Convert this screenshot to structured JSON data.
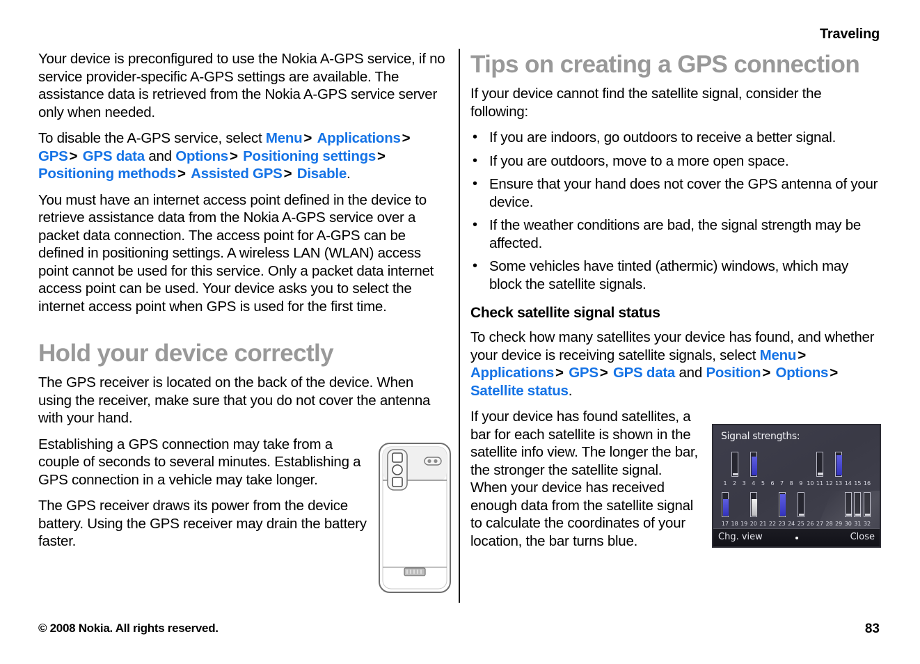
{
  "header": {
    "running_head": "Traveling"
  },
  "footer": {
    "copyright": "© 2008 Nokia. All rights reserved.",
    "page_number": "83"
  },
  "colors": {
    "link_blue": "#1573e6",
    "heading_gray": "#999999",
    "body_black": "#000000",
    "screen_bg": "#3a3a46",
    "bar_blue": "#3434bd"
  },
  "left_column": {
    "para_1": "Your device is preconfigured to use the Nokia A-GPS service, if no service provider-specific A-GPS settings are available. The assistance data is retrieved from the Nokia A-GPS service server only when needed.",
    "para_2_lead": "To disable the A-GPS service, select ",
    "path_1": [
      "Menu",
      "Applications",
      "GPS",
      "GPS data"
    ],
    "path_1_joiner": "and",
    "path_2": [
      "Options",
      "Positioning settings",
      "Positioning methods",
      "Assisted GPS",
      "Disable"
    ],
    "path_sep": ">",
    "path_end": ".",
    "para_3": "You must have an internet access point defined in the device to retrieve assistance data from the Nokia A-GPS service over a packet data connection. The access point for A-GPS can be defined in positioning settings. A wireless LAN (WLAN) access point cannot be used for this service. Only a packet data internet access point can be used. Your device asks you to select the internet access point when GPS is used for the first time.",
    "heading_hold": "Hold your device correctly",
    "para_4": "The GPS receiver is located on the back of the device. When using the receiver, make sure that you do not cover the antenna with your hand.",
    "para_5": "Establishing a GPS connection may take from a couple of seconds to several minutes. Establishing a GPS connection in a vehicle may take longer.",
    "para_6": "The GPS receiver draws its power from the device battery. Using the GPS receiver may drain the battery faster."
  },
  "right_column": {
    "heading_tips": "Tips on creating a GPS connection",
    "para_1": "If your device cannot find the satellite signal, consider the following:",
    "bullet_char": "•",
    "bullets": [
      "If you are indoors, go outdoors to receive a better signal.",
      "If you are outdoors, move to a more open space.",
      "Ensure that your hand does not cover the GPS antenna of your device.",
      "If the weather conditions are bad, the signal strength may be affected.",
      "Some vehicles have tinted (athermic) windows, which may block the satellite signals."
    ],
    "subheading_check": "Check satellite signal status",
    "para_2_lead": "To check how many satellites your device has found, and whether your device is receiving satellite signals, select ",
    "path_1": [
      "Menu",
      "Applications",
      "GPS",
      "GPS data"
    ],
    "path_1_joiner": "and",
    "path_2": [
      "Position",
      "Options",
      "Satellite status"
    ],
    "path_sep": ">",
    "path_end": ".",
    "para_3": "If your device has found satellites, a bar for each satellite is shown in the satellite info view. The longer the bar, the stronger the satellite signal. When your device has received enough data from the satellite signal to calculate the coordinates of your location, the bar turns blue."
  },
  "device_screenshot": {
    "title": "Signal strengths:",
    "softkey_left": "Chg. view",
    "softkey_right": "Close",
    "row_1_labels": [
      "1",
      "2",
      "3",
      "4",
      "5",
      "6",
      "7",
      "8",
      "9",
      "10",
      "11",
      "12",
      "13",
      "14",
      "15",
      "16"
    ],
    "row_2_labels": [
      "17",
      "18",
      "19",
      "20",
      "21",
      "22",
      "23",
      "24",
      "25",
      "26",
      "27",
      "28",
      "29",
      "30",
      "31",
      "32"
    ],
    "row_1_bars": [
      {
        "index": 2,
        "fill_percent": 8,
        "color": "outline"
      },
      {
        "index": 4,
        "fill_percent": 78,
        "color": "blue"
      },
      {
        "index": 11,
        "fill_percent": 12,
        "color": "outline"
      },
      {
        "index": 13,
        "fill_percent": 85,
        "color": "blue"
      }
    ],
    "row_2_bars": [
      {
        "index": 17,
        "fill_percent": 72,
        "color": "blue"
      },
      {
        "index": 20,
        "fill_percent": 70,
        "color": "white"
      },
      {
        "index": 23,
        "fill_percent": 92,
        "color": "blue"
      },
      {
        "index": 25,
        "fill_percent": 10,
        "color": "outline"
      },
      {
        "index": 30,
        "fill_percent": 10,
        "color": "outline"
      },
      {
        "index": 31,
        "fill_percent": 10,
        "color": "outline"
      },
      {
        "index": 32,
        "fill_percent": 10,
        "color": "outline"
      }
    ]
  },
  "phone_illustration": {
    "caption": ""
  }
}
